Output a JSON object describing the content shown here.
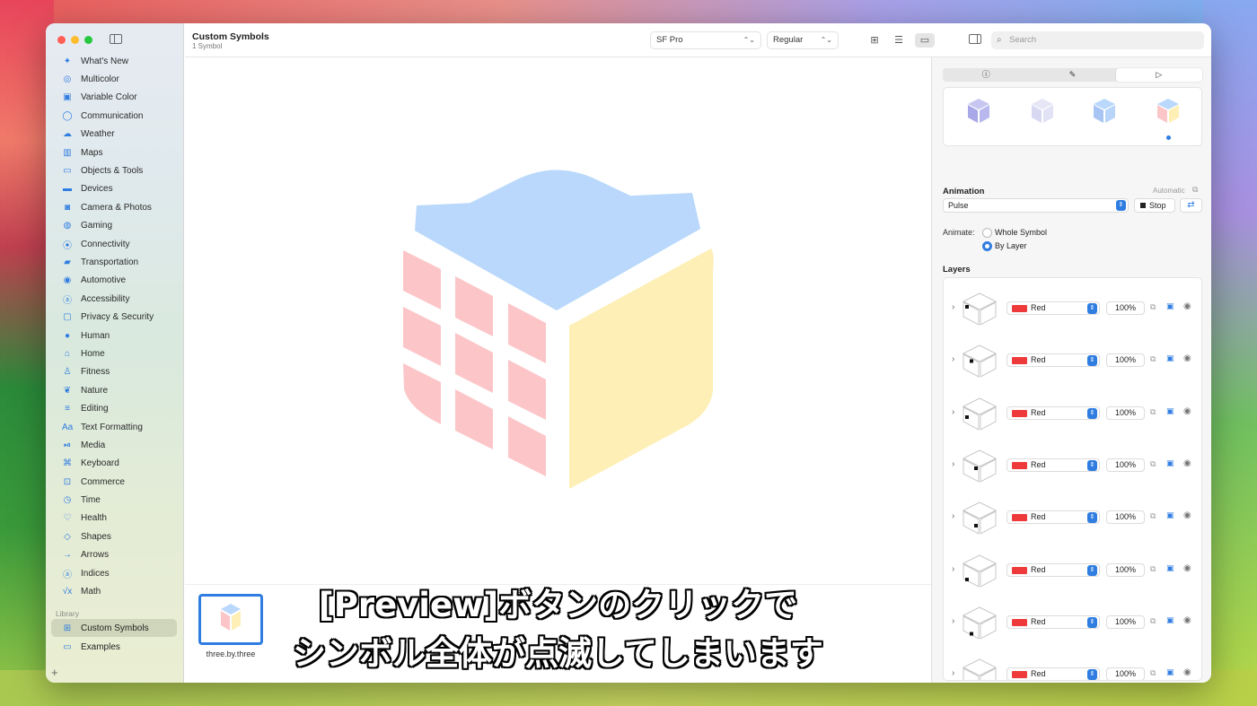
{
  "toolbar": {
    "title": "Custom Symbols",
    "subtitle": "1 Symbol",
    "font_select": "SF Pro",
    "weight_select": "Regular",
    "search_placeholder": "Search"
  },
  "sidebar": {
    "categories": [
      {
        "label": "What's New",
        "icon": "sparkle-icon",
        "glyph": "✦"
      },
      {
        "label": "Multicolor",
        "icon": "paintpalette-icon",
        "glyph": "◎"
      },
      {
        "label": "Variable Color",
        "icon": "variable-color-icon",
        "glyph": "▣"
      },
      {
        "label": "Communication",
        "icon": "message-bubble-icon",
        "glyph": "◯"
      },
      {
        "label": "Weather",
        "icon": "cloud-sun-icon",
        "glyph": "☁"
      },
      {
        "label": "Maps",
        "icon": "map-icon",
        "glyph": "▥"
      },
      {
        "label": "Objects & Tools",
        "icon": "folder-icon",
        "glyph": "▭"
      },
      {
        "label": "Devices",
        "icon": "display-icon",
        "glyph": "▬"
      },
      {
        "label": "Camera & Photos",
        "icon": "camera-icon",
        "glyph": "◙"
      },
      {
        "label": "Gaming",
        "icon": "gamecontroller-icon",
        "glyph": "◍"
      },
      {
        "label": "Connectivity",
        "icon": "antenna-icon",
        "glyph": "⦿"
      },
      {
        "label": "Transportation",
        "icon": "car-icon",
        "glyph": "▰"
      },
      {
        "label": "Automotive",
        "icon": "steeringwheel-icon",
        "glyph": "◉"
      },
      {
        "label": "Accessibility",
        "icon": "accessibility-icon",
        "glyph": "ⓐ"
      },
      {
        "label": "Privacy & Security",
        "icon": "lock-icon",
        "glyph": "▢"
      },
      {
        "label": "Human",
        "icon": "person-icon",
        "glyph": "●"
      },
      {
        "label": "Home",
        "icon": "house-icon",
        "glyph": "⌂"
      },
      {
        "label": "Fitness",
        "icon": "figure-run-icon",
        "glyph": "♙"
      },
      {
        "label": "Nature",
        "icon": "leaf-icon",
        "glyph": "❦"
      },
      {
        "label": "Editing",
        "icon": "slider-icon",
        "glyph": "≡"
      },
      {
        "label": "Text Formatting",
        "icon": "textformat-icon",
        "glyph": "Aa"
      },
      {
        "label": "Media",
        "icon": "playpause-icon",
        "glyph": "⏯"
      },
      {
        "label": "Keyboard",
        "icon": "command-icon",
        "glyph": "⌘"
      },
      {
        "label": "Commerce",
        "icon": "cart-icon",
        "glyph": "⊡"
      },
      {
        "label": "Time",
        "icon": "clock-icon",
        "glyph": "◷"
      },
      {
        "label": "Health",
        "icon": "heart-icon",
        "glyph": "♡"
      },
      {
        "label": "Shapes",
        "icon": "shapes-icon",
        "glyph": "◇"
      },
      {
        "label": "Arrows",
        "icon": "arrow-right-icon",
        "glyph": "→"
      },
      {
        "label": "Indices",
        "icon": "a-circle-icon",
        "glyph": "ⓐ"
      },
      {
        "label": "Math",
        "icon": "sqrt-icon",
        "glyph": "√x"
      }
    ],
    "library_heading": "Library",
    "library_items": [
      {
        "label": "Custom Symbols",
        "icon": "grid-icon",
        "glyph": "⊞"
      },
      {
        "label": "Examples",
        "icon": "folder-icon",
        "glyph": "▭"
      }
    ],
    "add_label": "+"
  },
  "canvas": {
    "thumbnail_label": "three.by.three",
    "caption_line1": "[Preview]ボタンのクリックで",
    "caption_line2": "シンボル全体が点滅してしまいます"
  },
  "inspector": {
    "tabs": [
      {
        "icon": "info-icon",
        "glyph": "ⓘ"
      },
      {
        "icon": "paintbrush-icon",
        "glyph": "✎"
      },
      {
        "icon": "play-icon",
        "glyph": "▷"
      }
    ],
    "animation_title": "Animation",
    "automatic_label": "Automatic",
    "animation_value": "Pulse",
    "stop_label": "Stop",
    "animate_label": "Animate:",
    "option_whole": "Whole Symbol",
    "option_layer": "By Layer",
    "layers_title": "Layers",
    "layers": [
      {
        "color": "Red",
        "opacity": "100%"
      },
      {
        "color": "Red",
        "opacity": "100%"
      },
      {
        "color": "Red",
        "opacity": "100%"
      },
      {
        "color": "Red",
        "opacity": "100%"
      },
      {
        "color": "Red",
        "opacity": "100%"
      },
      {
        "color": "Red",
        "opacity": "100%"
      },
      {
        "color": "Red",
        "opacity": "100%"
      },
      {
        "color": "Red",
        "opacity": "100%"
      }
    ],
    "footer_add": "+⌄",
    "footer_more": "⊖⌄"
  },
  "colors": {
    "accent": "#2f7de1",
    "cube_top": "#b9d8fb",
    "cube_left": "#fcc6c9",
    "cube_right": "#fdefb5",
    "layer_swatch": "#ee3a3a"
  }
}
